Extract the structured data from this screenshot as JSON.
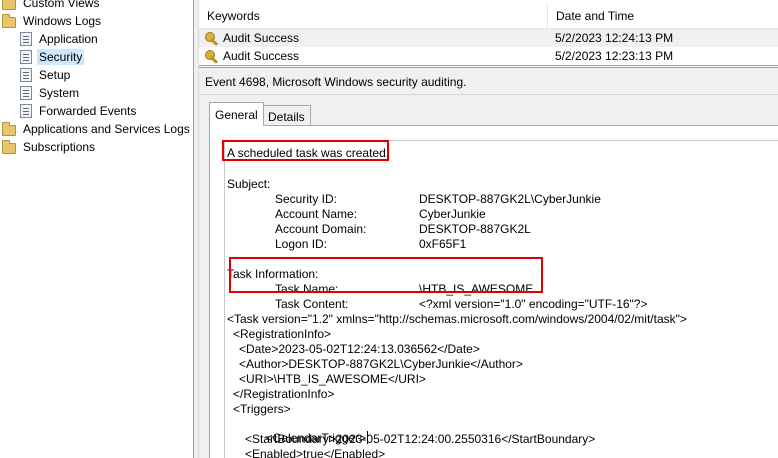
{
  "tree": {
    "items": [
      {
        "label": "Custom Views",
        "icon": "folder-icon"
      },
      {
        "label": "Windows Logs",
        "icon": "folder-open-icon"
      },
      {
        "label": "Application",
        "icon": "log-icon"
      },
      {
        "label": "Security",
        "icon": "log-icon",
        "selected": true
      },
      {
        "label": "Setup",
        "icon": "log-icon"
      },
      {
        "label": "System",
        "icon": "log-icon"
      },
      {
        "label": "Forwarded Events",
        "icon": "log-icon"
      },
      {
        "label": "Applications and Services Logs",
        "icon": "folder-icon"
      },
      {
        "label": "Subscriptions",
        "icon": "subscriptions-icon"
      }
    ]
  },
  "event_list": {
    "columns": [
      "Keywords",
      "Date and Time"
    ],
    "rows": [
      {
        "keywords": "Audit Success",
        "date": "5/2/2023 12:24:13 PM"
      },
      {
        "keywords": "Audit Success",
        "date": "5/2/2023 12:23:13 PM"
      }
    ]
  },
  "details": {
    "title": "Event 4698, Microsoft Windows security auditing.",
    "tabs": {
      "general": "General",
      "details": "Details"
    },
    "headline": "A scheduled task was created.",
    "subject_heading": "Subject:",
    "subject": {
      "security_id_label": "Security ID:",
      "security_id_value": "DESKTOP-887GK2L\\CyberJunkie",
      "account_name_label": "Account Name:",
      "account_name_value": "CyberJunkie",
      "account_domain_label": "Account Domain:",
      "account_domain_value": "DESKTOP-887GK2L",
      "logon_id_label": "Logon ID:",
      "logon_id_value": "0xF65F1"
    },
    "task_heading": "Task Information:",
    "task": {
      "task_name_label": "Task Name:",
      "task_name_value": "\\HTB_IS_AWESOME",
      "task_content_label": "Task Content:",
      "task_content_value": "<?xml version=\"1.0\" encoding=\"UTF-16\"?>"
    },
    "xml_lines": [
      "<Task version=\"1.2\" xmlns=\"http://schemas.microsoft.com/windows/2004/02/mit/task\">",
      "<RegistrationInfo>",
      "<Date>2023-05-02T12:24:13.036562</Date>",
      "<Author>DESKTOP-887GK2L\\CyberJunkie</Author>",
      "<URI>\\HTB_IS_AWESOME</URI>",
      "</RegistrationInfo>",
      "<Triggers>",
      "<CalendarTrigger>",
      "<StartBoundary>2023-05-02T12:24:00.2550316</StartBoundary>",
      "<Enabled>true</Enabled>"
    ]
  },
  "colors": {
    "highlight_box": "#e00000",
    "selection": "#cce8ff"
  }
}
